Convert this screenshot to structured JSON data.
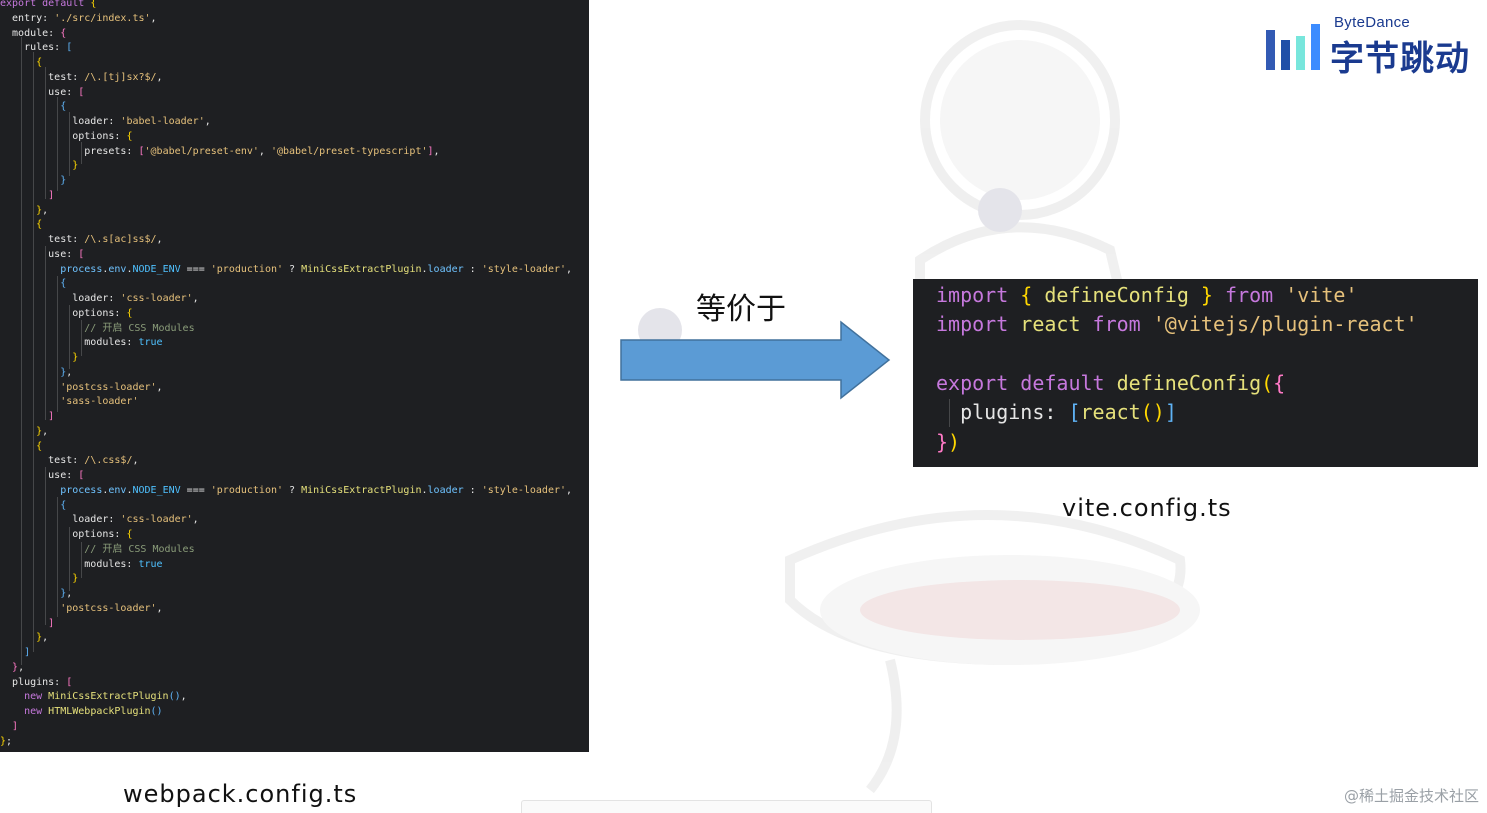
{
  "webpack_code": [
    [
      [
        "k",
        "export default "
      ],
      [
        "y",
        "{"
      ]
    ],
    [
      [
        "p",
        "  entry: "
      ],
      [
        "s",
        "'./src/index.ts'"
      ],
      [
        "p",
        ","
      ]
    ],
    [
      [
        "p",
        "  module: "
      ],
      [
        "m",
        "{"
      ]
    ],
    [
      [
        "p",
        "    rules: "
      ],
      [
        "b",
        "["
      ]
    ],
    [
      [
        "y",
        "      {"
      ]
    ],
    [
      [
        "p",
        "        test: "
      ],
      [
        "s",
        "/\\.[tj]sx?$/"
      ],
      [
        "p",
        ","
      ]
    ],
    [
      [
        "p",
        "        use: "
      ],
      [
        "m",
        "["
      ]
    ],
    [
      [
        "b",
        "          {"
      ]
    ],
    [
      [
        "p",
        "            loader: "
      ],
      [
        "s",
        "'babel-loader'"
      ],
      [
        "p",
        ","
      ]
    ],
    [
      [
        "p",
        "            options: "
      ],
      [
        "y",
        "{"
      ]
    ],
    [
      [
        "p",
        "              presets: "
      ],
      [
        "m",
        "["
      ],
      [
        "s",
        "'@babel/preset-env'"
      ],
      [
        "p",
        ", "
      ],
      [
        "s",
        "'@babel/preset-typescript'"
      ],
      [
        "m",
        "]"
      ],
      [
        "p",
        ","
      ]
    ],
    [
      [
        "y",
        "            }"
      ]
    ],
    [
      [
        "b",
        "          }"
      ]
    ],
    [
      [
        "m",
        "        ]"
      ]
    ],
    [
      [
        "y",
        "      }"
      ],
      [
        "p",
        ","
      ]
    ],
    [
      [
        "y",
        "      {"
      ]
    ],
    [
      [
        "p",
        "        test: "
      ],
      [
        "s",
        "/\\.s[ac]ss$/"
      ],
      [
        "p",
        ","
      ]
    ],
    [
      [
        "p",
        "        use: "
      ],
      [
        "m",
        "["
      ]
    ],
    [
      [
        "v",
        "          process"
      ],
      [
        "p",
        "."
      ],
      [
        "v",
        "env"
      ],
      [
        "p",
        "."
      ],
      [
        "t",
        "NODE_ENV"
      ],
      [
        "p",
        " === "
      ],
      [
        "s",
        "'production'"
      ],
      [
        "p",
        " ? "
      ],
      [
        "f",
        "MiniCssExtractPlugin"
      ],
      [
        "p",
        "."
      ],
      [
        "v",
        "loader"
      ],
      [
        "p",
        " : "
      ],
      [
        "s",
        "'style-loader'"
      ],
      [
        "p",
        ","
      ]
    ],
    [
      [
        "b",
        "          {"
      ]
    ],
    [
      [
        "p",
        "            loader: "
      ],
      [
        "s",
        "'css-loader'"
      ],
      [
        "p",
        ","
      ]
    ],
    [
      [
        "p",
        "            options: "
      ],
      [
        "y",
        "{"
      ]
    ],
    [
      [
        "c",
        "              // 开启 CSS Modules"
      ]
    ],
    [
      [
        "p",
        "              modules: "
      ],
      [
        "t",
        "true"
      ]
    ],
    [
      [
        "y",
        "            }"
      ]
    ],
    [
      [
        "b",
        "          }"
      ],
      [
        "p",
        ","
      ]
    ],
    [
      [
        "s",
        "          'postcss-loader'"
      ],
      [
        "p",
        ","
      ]
    ],
    [
      [
        "s",
        "          'sass-loader'"
      ]
    ],
    [
      [
        "m",
        "        ]"
      ]
    ],
    [
      [
        "y",
        "      }"
      ],
      [
        "p",
        ","
      ]
    ],
    [
      [
        "y",
        "      {"
      ]
    ],
    [
      [
        "p",
        "        test: "
      ],
      [
        "s",
        "/\\.css$/"
      ],
      [
        "p",
        ","
      ]
    ],
    [
      [
        "p",
        "        use: "
      ],
      [
        "m",
        "["
      ]
    ],
    [
      [
        "v",
        "          process"
      ],
      [
        "p",
        "."
      ],
      [
        "v",
        "env"
      ],
      [
        "p",
        "."
      ],
      [
        "t",
        "NODE_ENV"
      ],
      [
        "p",
        " === "
      ],
      [
        "s",
        "'production'"
      ],
      [
        "p",
        " ? "
      ],
      [
        "f",
        "MiniCssExtractPlugin"
      ],
      [
        "p",
        "."
      ],
      [
        "v",
        "loader"
      ],
      [
        "p",
        " : "
      ],
      [
        "s",
        "'style-loader'"
      ],
      [
        "p",
        ","
      ]
    ],
    [
      [
        "b",
        "          {"
      ]
    ],
    [
      [
        "p",
        "            loader: "
      ],
      [
        "s",
        "'css-loader'"
      ],
      [
        "p",
        ","
      ]
    ],
    [
      [
        "p",
        "            options: "
      ],
      [
        "y",
        "{"
      ]
    ],
    [
      [
        "c",
        "              // 开启 CSS Modules"
      ]
    ],
    [
      [
        "p",
        "              modules: "
      ],
      [
        "t",
        "true"
      ]
    ],
    [
      [
        "y",
        "            }"
      ]
    ],
    [
      [
        "b",
        "          }"
      ],
      [
        "p",
        ","
      ]
    ],
    [
      [
        "s",
        "          'postcss-loader'"
      ],
      [
        "p",
        ","
      ]
    ],
    [
      [
        "m",
        "        ]"
      ]
    ],
    [
      [
        "y",
        "      }"
      ],
      [
        "p",
        ","
      ]
    ],
    [
      [
        "b",
        "    ]"
      ]
    ],
    [
      [
        "m",
        "  }"
      ],
      [
        "p",
        ","
      ]
    ],
    [
      [
        "p",
        "  plugins: "
      ],
      [
        "m",
        "["
      ]
    ],
    [
      [
        "k",
        "    new "
      ],
      [
        "f",
        "MiniCssExtractPlugin"
      ],
      [
        "b",
        "()"
      ],
      [
        "p",
        ","
      ]
    ],
    [
      [
        "k",
        "    new "
      ],
      [
        "f",
        "HTMLWebpackPlugin"
      ],
      [
        "b",
        "()"
      ]
    ],
    [
      [
        "m",
        "  ]"
      ]
    ],
    [
      [
        "y",
        "}"
      ],
      [
        "p",
        ";"
      ]
    ]
  ],
  "vite_code": [
    [
      [
        "k",
        "import "
      ],
      [
        "y",
        "{ "
      ],
      [
        "f",
        "defineConfig"
      ],
      [
        "y",
        " }"
      ],
      [
        "k",
        " from "
      ],
      [
        "s",
        "'vite'"
      ]
    ],
    [
      [
        "k",
        "import "
      ],
      [
        "f",
        "react"
      ],
      [
        "k",
        " from "
      ],
      [
        "s",
        "'@vitejs/plugin-react'"
      ]
    ],
    [],
    [
      [
        "k",
        "export default "
      ],
      [
        "f",
        "defineConfig"
      ],
      [
        "y",
        "("
      ],
      [
        "m",
        "{"
      ]
    ],
    [
      [
        "p",
        "  plugins: "
      ],
      [
        "b",
        "["
      ],
      [
        "f",
        "react"
      ],
      [
        "y",
        "()"
      ],
      [
        "b",
        "]"
      ]
    ],
    [
      [
        "m",
        "}"
      ],
      [
        "y",
        ")"
      ]
    ]
  ],
  "labels": {
    "equivalent": "等价于",
    "vite_file": "vite.config.ts",
    "webpack_file": "webpack.config.ts"
  },
  "logo": {
    "en": "ByteDance",
    "cn": "字节跳动"
  },
  "footer": "@稀土掘金技术社区",
  "colors": {
    "arrow_fill": "#5b9bd5",
    "arrow_stroke": "#41719c",
    "code_bg": "#1e1f22",
    "logo_blue": "#1a3a8f"
  }
}
